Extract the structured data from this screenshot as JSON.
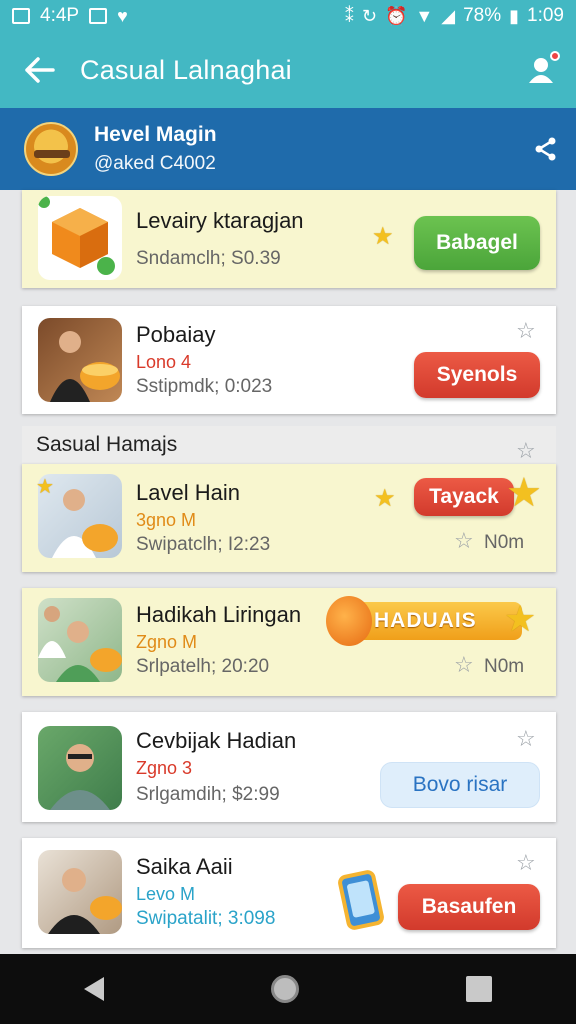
{
  "status_bar": {
    "left_time": "4:4P",
    "battery": "78%",
    "time": "1:09"
  },
  "app_bar": {
    "title": "Casual Lalnaghai",
    "back_icon": "back-arrow-icon",
    "profile_icon": "person-icon"
  },
  "user": {
    "name": "Hevel Magin",
    "handle": "@aked C4002",
    "share_icon": "share-icon"
  },
  "cards": [
    {
      "title": "Levairy ktaragjan",
      "sub1": "",
      "sub2": "Sndamclh;  S0.39",
      "button": "Babagel",
      "button_color": "#52ac3e"
    },
    {
      "title": "Pobaiay",
      "sub1": "Lono  4",
      "sub2": "Sstipmdk;  0:023",
      "button": "Syenols",
      "button_color": "#dc4332"
    }
  ],
  "section": {
    "title": "Sasual Hamajs"
  },
  "cards2": [
    {
      "title": "Lavel Hain",
      "sub1": "3gno  M",
      "sub2": "Swipatclh;  I2:23",
      "right_meta": "N0m",
      "button": "Tayack",
      "button_color": "#dc4332"
    },
    {
      "title": "Hadikah Liringan",
      "sub1": "Zgno  M",
      "sub2": "Srlpatelh;  20:20",
      "right_meta": "N0m",
      "banner": "HADUAIS"
    },
    {
      "title": "Cevbijak Hadian",
      "sub1": "Zgno  3",
      "sub2": "Srlgamdih;  $2:99",
      "button": "Bovo risar"
    },
    {
      "title": "Saika Aaii",
      "sub1": "Levo  M",
      "sub2": "Swipatalit;  3:098",
      "button": "Basaufen",
      "button_color": "#dc4332"
    }
  ]
}
